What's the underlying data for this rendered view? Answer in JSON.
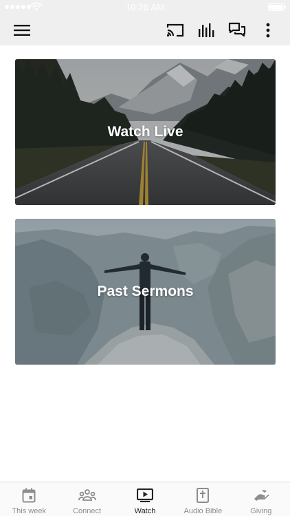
{
  "status_bar": {
    "time": "10:26 AM",
    "icons": [
      "signal-dots-icon",
      "wifi-icon",
      "battery-icon"
    ]
  },
  "top_bar": {
    "icons": [
      "menu-icon",
      "cast-icon",
      "equalizer-icon",
      "chat-icon",
      "more-vert-icon"
    ]
  },
  "cards": [
    {
      "title": "Watch Live",
      "image": "mountain-road-image"
    },
    {
      "title": "Past Sermons",
      "image": "man-on-cliff-image"
    }
  ],
  "tabs": [
    {
      "label": "This week",
      "icon": "calendar-icon",
      "active": false
    },
    {
      "label": "Connect",
      "icon": "people-icon",
      "active": false
    },
    {
      "label": "Watch",
      "icon": "play-screen-icon",
      "active": true
    },
    {
      "label": "Audio Bible",
      "icon": "bible-icon",
      "active": false
    },
    {
      "label": "Giving",
      "icon": "giving-hand-icon",
      "active": false
    }
  ],
  "colors": {
    "header_bg": "#efefef",
    "tab_active": "#222222",
    "tab_inactive": "#8d8d8d"
  }
}
